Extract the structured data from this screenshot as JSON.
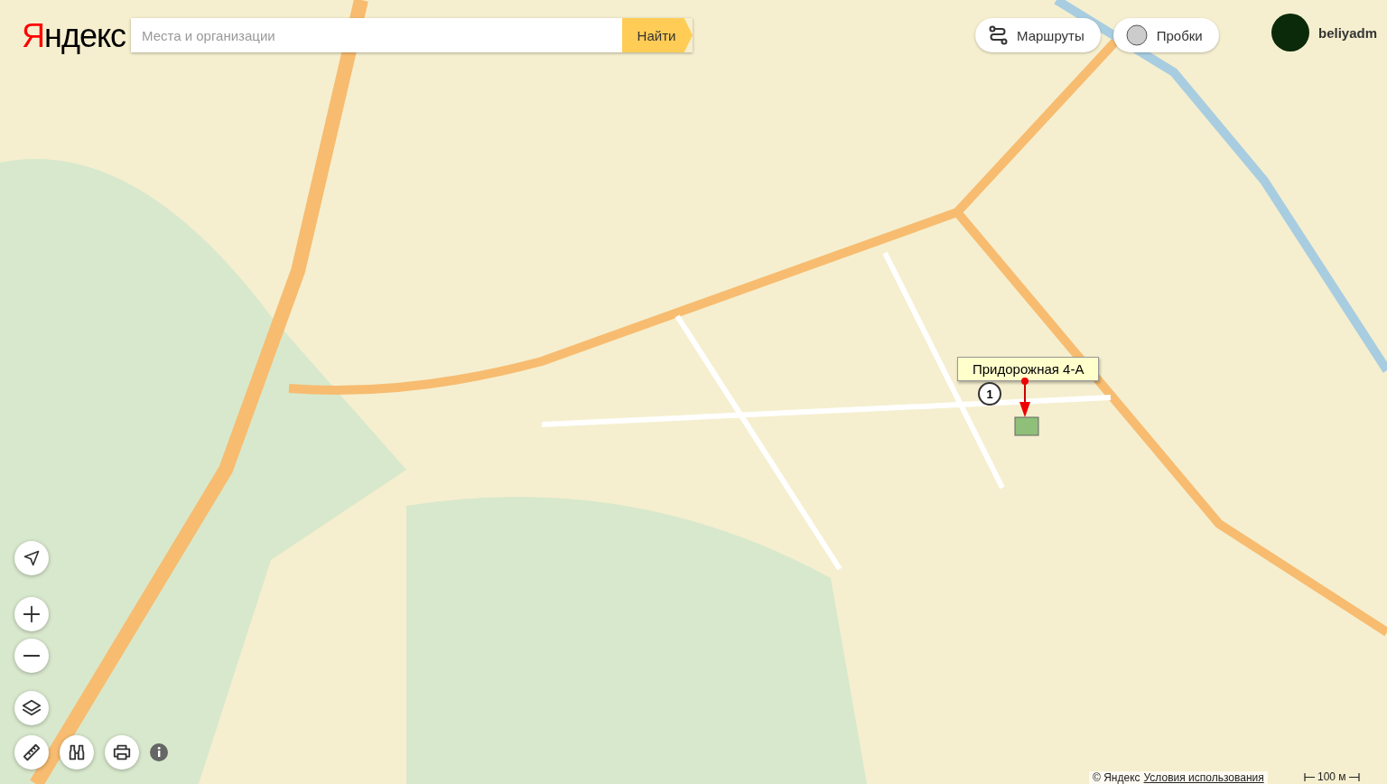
{
  "header": {
    "logo": "Яндекс",
    "search": {
      "placeholder": "Места и организации"
    },
    "search_button": "Найти"
  },
  "buttons": [
    {
      "label": "Маршруты",
      "kind": "routes"
    },
    {
      "label": "Пробки",
      "kind": "traffic"
    }
  ],
  "user": {
    "name": "beliyadm"
  },
  "placemark": {
    "label": "Придорожная 4-А",
    "number": "1"
  },
  "footer": {
    "copyright": "© Яндекс",
    "terms_link": "Условия использования",
    "scale": "100 м"
  }
}
